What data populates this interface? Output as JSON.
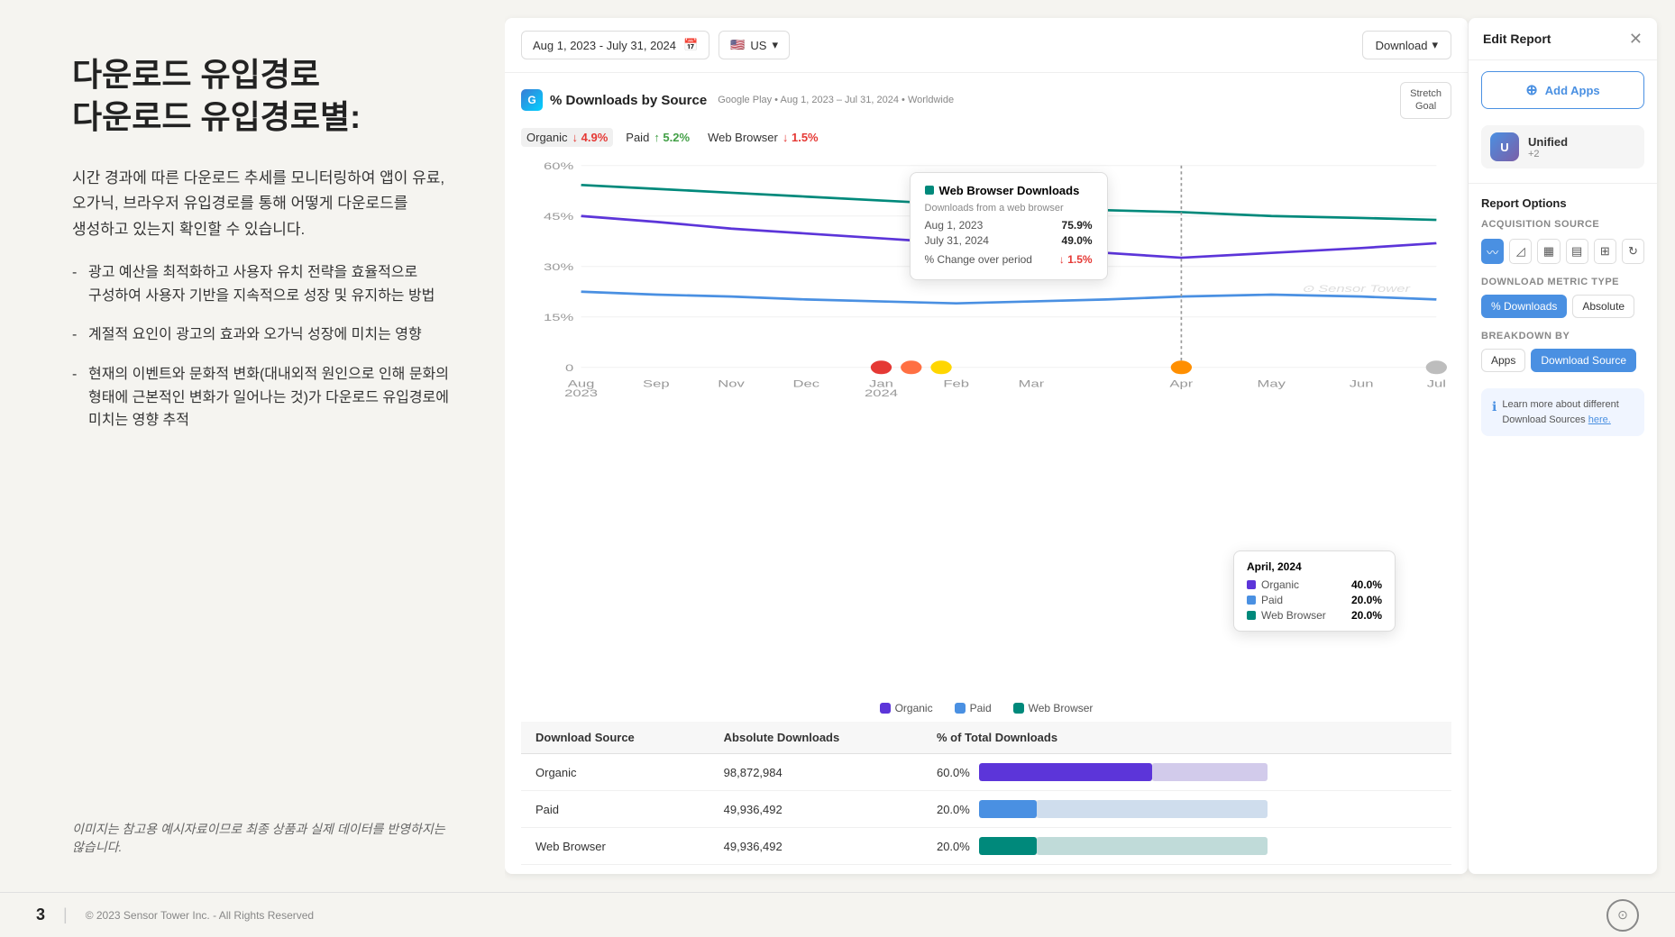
{
  "page": {
    "title_line1": "다운로드 유입경로",
    "title_line2": "다운로드 유입경로별:",
    "description": "시간 경과에 따른 다운로드 추세를 모니터링하여 앱이 유료, 오가닉, 브라우저 유입경로를 통해 어떻게 다운로드를 생성하고 있는지 확인할 수 있습니다.",
    "bullets": [
      "광고 예산을 최적화하고 사용자 유치 전략을 효율적으로 구성하여 사용자 기반을 지속적으로 성장 및 유지하는 방법",
      "계절적 요인이 광고의 효과와 오가닉 성장에 미치는 영향",
      "현재의 이벤트와 문화적 변화(대내외적 원인으로 인해 문화의 형태에 근본적인 변화가 일어나는 것)가 다운로드 유입경로에 미치는 영향 추적"
    ],
    "disclaimer": "이미지는 참고용 예시자료이므로 최종 상품과 실제 데이터를 반영하지는 않습니다.",
    "page_number": "3",
    "footer_copy": "© 2023 Sensor Tower Inc. - All Rights Reserved"
  },
  "toolbar": {
    "date_range": "Aug 1, 2023 - July 31, 2024",
    "region": "US",
    "download_label": "Download"
  },
  "chart": {
    "title": "% Downloads by Source",
    "subtitle": "Google Play • Aug 1, 2023 – Jul 31, 2024 • Worldwide",
    "app_icon_label": "G",
    "stretch_goal_line1": "Stretch",
    "stretch_goal_line2": "Goal",
    "metrics": [
      {
        "label": "Organic",
        "pct": "4.9%",
        "direction": "down"
      },
      {
        "label": "Paid",
        "pct": "5.2%",
        "direction": "up"
      },
      {
        "label": "Web Browser",
        "pct": "1.5%",
        "direction": "down"
      }
    ],
    "y_labels": [
      "60%",
      "45%",
      "30%",
      "15%",
      "0"
    ],
    "x_labels": [
      "Aug\n2023",
      "Sep",
      "Nov",
      "Dec",
      "Jan\n2024",
      "Feb",
      "Mar",
      "Apr",
      "May",
      "Jun",
      "Jul"
    ],
    "legend": [
      {
        "label": "Organic",
        "color": "#5c35d9"
      },
      {
        "label": "Paid",
        "color": "#4a90e2"
      },
      {
        "label": "Web Browser",
        "color": "#00897b"
      }
    ]
  },
  "tooltip_web_browser": {
    "title": "Web Browser Downloads",
    "desc": "Downloads from a web browser",
    "row1_label": "Aug 1, 2023",
    "row1_val": "75.9%",
    "row2_label": "July 31, 2024",
    "row2_val": "49.0%",
    "change_label": "% Change over period",
    "change_val": "↓ 1.5%"
  },
  "tooltip_april": {
    "title": "April, 2024",
    "rows": [
      {
        "label": "Organic",
        "val": "40.0%"
      },
      {
        "label": "Paid",
        "val": "20.0%"
      },
      {
        "label": "Web Browser",
        "val": "20.0%"
      }
    ]
  },
  "table": {
    "headers": [
      "Download Source",
      "Absolute Downloads",
      "% of Total Downloads"
    ],
    "rows": [
      {
        "source": "Organic",
        "absolute": "98,872,984",
        "pct": "60.0%",
        "bar_pct": 60,
        "color": "#5c35d9"
      },
      {
        "source": "Paid",
        "absolute": "49,936,492",
        "pct": "20.0%",
        "bar_pct": 20,
        "color": "#4a90e2"
      },
      {
        "source": "Web Browser",
        "absolute": "49,936,492",
        "pct": "20.0%",
        "bar_pct": 20,
        "color": "#00897b"
      }
    ]
  },
  "edit_panel": {
    "title": "Edit Report",
    "add_apps_label": "Add Apps",
    "unified_label": "Unified",
    "unified_sub": "+2",
    "report_options_label": "Report Options",
    "acquisition_source_label": "ACQUISITION SOURCE",
    "download_metric_type_label": "Download Metric Type",
    "metric_type_options": [
      {
        "label": "% Downloads",
        "active": true
      },
      {
        "label": "Absolute",
        "active": false
      }
    ],
    "breakdown_by_label": "Breakdown By",
    "breakdown_options": [
      {
        "label": "Apps",
        "active": false
      },
      {
        "label": "Download Source",
        "active": true
      }
    ],
    "info_text": "Learn more about different Download Sources ",
    "info_link": "here."
  }
}
